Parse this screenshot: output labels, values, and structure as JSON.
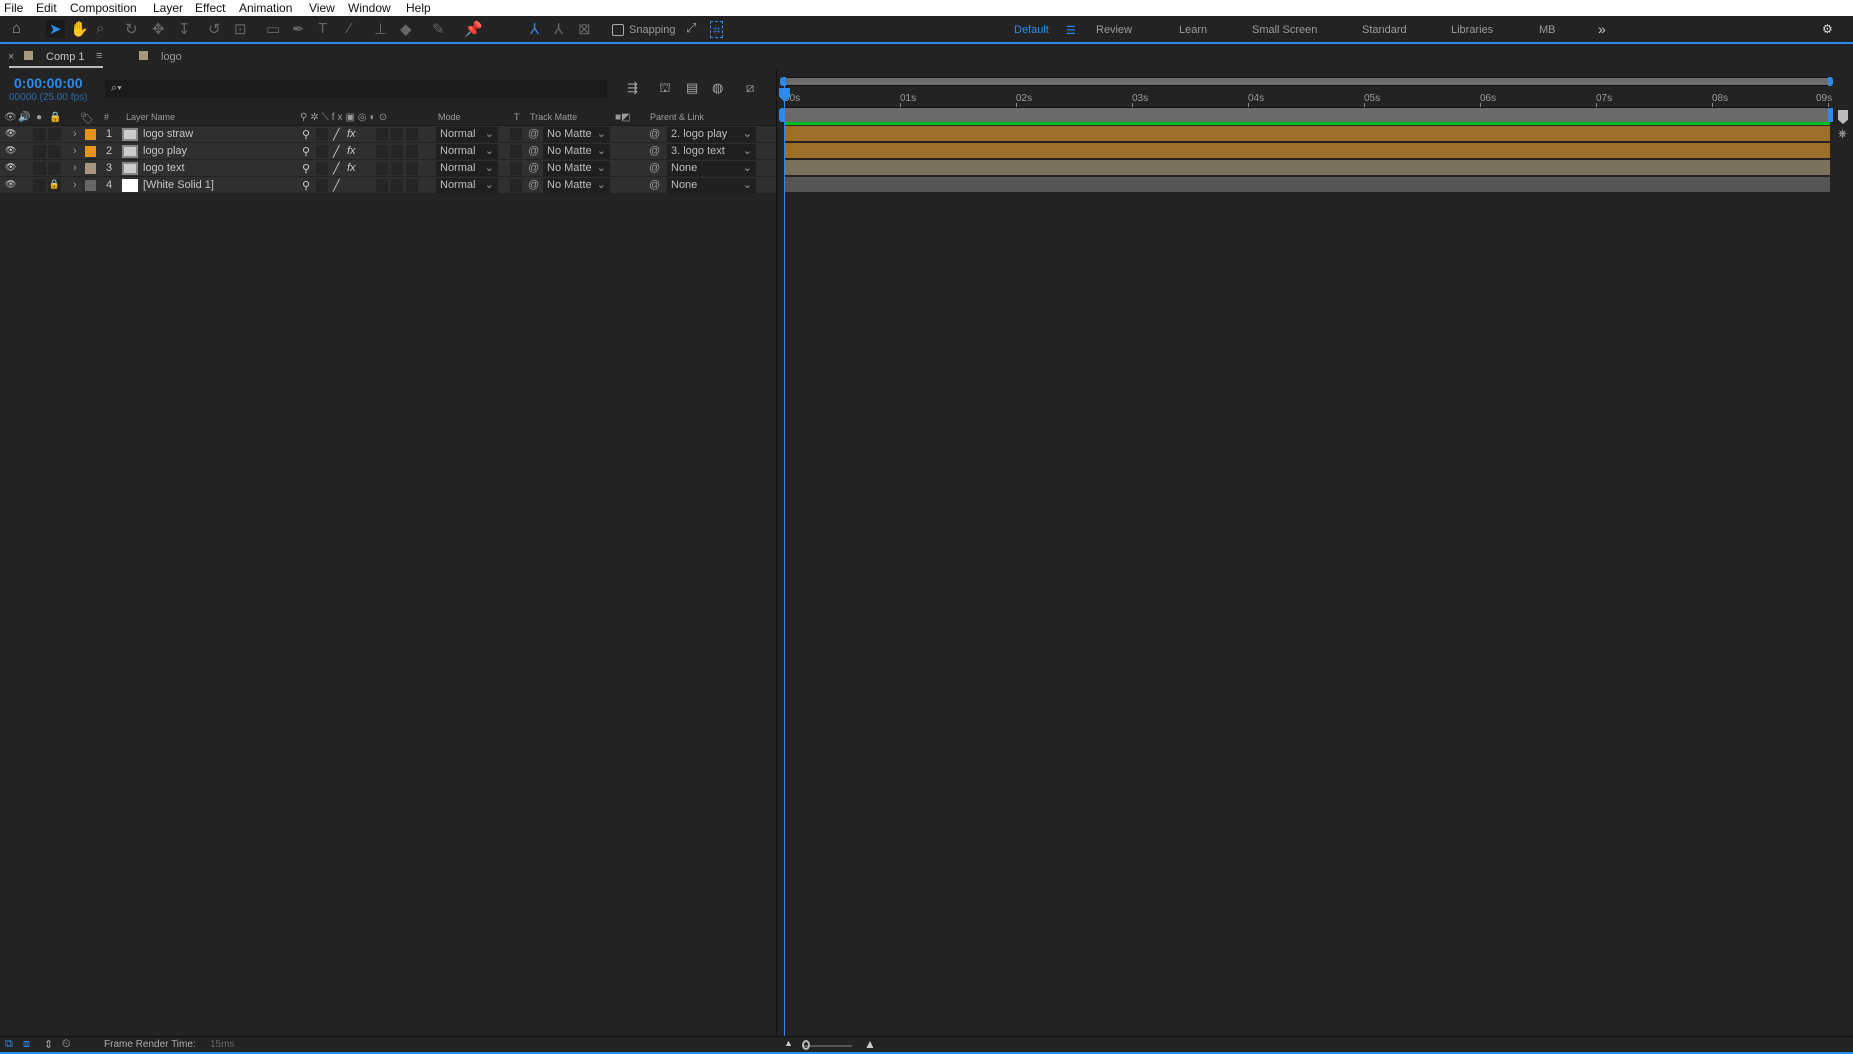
{
  "menu": [
    "File",
    "Edit",
    "Composition",
    "Layer",
    "Effect",
    "Animation",
    "View",
    "Window",
    "Help"
  ],
  "toolbar": {
    "snapping_label": "Snapping",
    "snapping_checked": false
  },
  "workspaces": {
    "items": [
      "Default",
      "Review",
      "Learn",
      "Small Screen",
      "Standard",
      "Libraries",
      "MB"
    ],
    "active": "Default",
    "more": "»"
  },
  "tabs": [
    {
      "label": "Comp 1",
      "active": true,
      "swatch": "#a8977a"
    },
    {
      "label": "logo",
      "active": false,
      "swatch": "#a8977a"
    }
  ],
  "timecode": {
    "value": "0:00:00:00",
    "frames": "00000 (25.00 fps)"
  },
  "search": {
    "placeholder": "",
    "value": ""
  },
  "headers": {
    "num": "#",
    "layer_name": "Layer Name",
    "mode": "Mode",
    "t": "T",
    "track_matte": "Track Matte",
    "parent": "Parent & Link"
  },
  "layers": [
    {
      "num": "1",
      "name": "logo straw",
      "label_color": "#e8941a",
      "mode": "Normal",
      "matte": "No Matte",
      "parent": "2. logo play",
      "fx": true,
      "locked": false,
      "bar_color": "#9b6e2a"
    },
    {
      "num": "2",
      "name": "logo play",
      "label_color": "#e8941a",
      "mode": "Normal",
      "matte": "No Matte",
      "parent": "3. logo text",
      "fx": true,
      "locked": false,
      "bar_color": "#9b6e2a"
    },
    {
      "num": "3",
      "name": "logo text",
      "label_color": "#a8977a",
      "mode": "Normal",
      "matte": "No Matte",
      "parent": "None",
      "fx": true,
      "locked": false,
      "bar_color": "#7a705e"
    },
    {
      "num": "4",
      "name": "[White Solid 1]",
      "label_color": "#666666",
      "mode": "Normal",
      "matte": "No Matte",
      "parent": "None",
      "fx": false,
      "locked": true,
      "bar_color": "#555555"
    }
  ],
  "ruler": [
    "00s",
    "01s",
    "02s",
    "03s",
    "04s",
    "05s",
    "06s",
    "07s",
    "08s",
    "09s"
  ],
  "status": {
    "label": "Frame Render Time:",
    "value": "15ms"
  },
  "colors": {
    "accent": "#2d8ceb",
    "work_area": "#00c020"
  }
}
